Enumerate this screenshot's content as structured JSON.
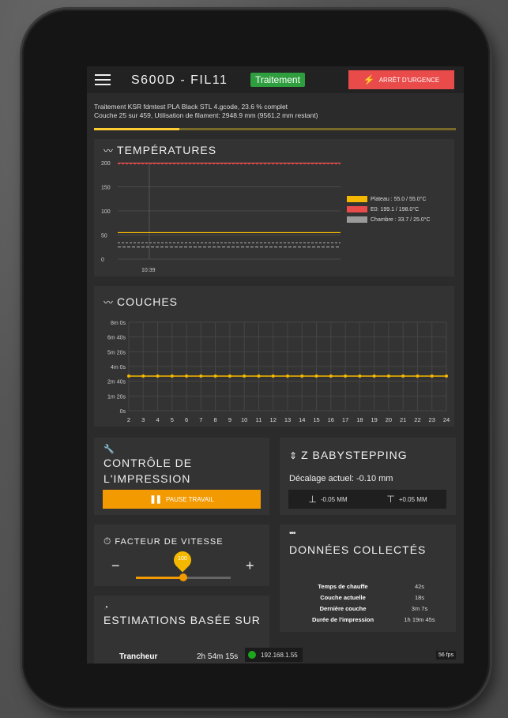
{
  "header": {
    "printer_name": "S600D - FIL11",
    "status": "Traitement",
    "emergency_label": "ARRÊT D'URGENCE"
  },
  "job": {
    "line1": "Traitement KSR fdmtest PLA Black STL 4.gcode, 23.6 % complet",
    "line2": "Couche 25 sur 459, Utilisation de filament: 2948.9 mm (9561.2 mm restant)",
    "progress_fraction": 0.236
  },
  "temperatures": {
    "title": "TEMPÉRATURES",
    "y_ticks": [
      "200",
      "150",
      "100",
      "50",
      "0"
    ],
    "x_tick": "10:39",
    "legend": [
      {
        "label": "Plateau : 55.0 / 55.0°C",
        "color": "#f5b800"
      },
      {
        "label": "E0: 199.1 / 198.0°C",
        "color": "#e94a4a"
      },
      {
        "label": "Chambre : 33.7 / 25.0°C",
        "color": "#9a9a9a"
      }
    ]
  },
  "chart_data": {
    "type": "line",
    "title": "COUCHES",
    "categories": [
      "2",
      "3",
      "4",
      "5",
      "6",
      "7",
      "8",
      "9",
      "10",
      "11",
      "12",
      "13",
      "14",
      "15",
      "16",
      "17",
      "18",
      "19",
      "20",
      "21",
      "22",
      "23",
      "24"
    ],
    "y_ticks": [
      "8m 0s",
      "6m 40s",
      "5m 20s",
      "4m 0s",
      "2m 40s",
      "1m 20s",
      "0s"
    ],
    "series": [
      {
        "values": [
          188,
          188,
          188,
          188,
          188,
          188,
          188,
          188,
          188,
          188,
          188,
          188,
          188,
          188,
          188,
          188,
          188,
          188,
          188,
          188,
          188,
          188,
          188
        ]
      }
    ],
    "ylim": [
      0,
      480
    ],
    "color": "#f5b800",
    "grid": true
  },
  "control": {
    "title": "CONTRÔLE DE L'IMPRESSION",
    "pause_label": "PAUSE TRAVAIL"
  },
  "babystep": {
    "title": "Z BABYSTEPPING",
    "offset": "Décalage actuel: -0.10 mm",
    "down_label": "-0.05 MM",
    "up_label": "+0.05 MM"
  },
  "speed": {
    "title": "FACTEUR DE VITESSE",
    "value": "100",
    "minus": "−",
    "plus": "+"
  },
  "data_panel": {
    "title": "DONNÉES COLLECTÉS",
    "rows": [
      {
        "k": "Temps de chauffe",
        "v": "42s"
      },
      {
        "k": "Couche actuelle",
        "v": "18s"
      },
      {
        "k": "Dernière couche",
        "v": "3m 7s"
      },
      {
        "k": "Durée de l'impression",
        "v": "1h 19m 45s"
      }
    ]
  },
  "estimations": {
    "title": "ESTIMATIONS BASÉE SUR",
    "label": "Trancheur",
    "value": "2h 54m 15s"
  },
  "footer": {
    "ip": "192.168.1.55",
    "fps": "56 fps"
  }
}
